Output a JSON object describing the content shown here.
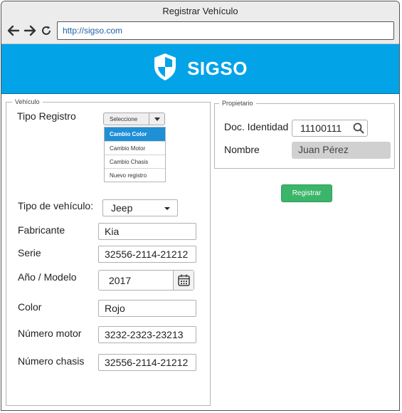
{
  "window": {
    "title": "Registrar Vehículo",
    "url": "http://sigso.com"
  },
  "header": {
    "brand": "SIGSO",
    "logo_icon": "shield-icon"
  },
  "vehiculo": {
    "legend": "Vehículo",
    "tipo_registro": {
      "label": "Tipo Registro",
      "select_value": "Seleccione",
      "options": [
        "Cambio Color",
        "Cambio Motor",
        "Cambio Chasis",
        "Nuevo registro"
      ],
      "highlighted": "Cambio Color"
    },
    "tipo_vehiculo": {
      "label": "Tipo de vehículo:",
      "value": "Jeep"
    },
    "fabricante": {
      "label": "Fabricante",
      "value": "Kia"
    },
    "serie": {
      "label": "Serie",
      "value": "32556-2114-21212"
    },
    "anio_modelo": {
      "label": "Año / Modelo",
      "value": "2017",
      "icon": "calendar-icon"
    },
    "color": {
      "label": "Color",
      "value": "Rojo"
    },
    "numero_motor": {
      "label": "Número motor",
      "value": "3232-2323-23213"
    },
    "numero_chasis": {
      "label": "Número chasis",
      "value": "32556-2114-21212"
    }
  },
  "propietario": {
    "legend": "Propietario",
    "doc_identidad": {
      "label": "Doc. Identidad",
      "value": "11100111",
      "icon": "search-icon"
    },
    "nombre": {
      "label": "Nombre",
      "value": "Juan Pérez"
    }
  },
  "actions": {
    "register_label": "Registrar"
  },
  "colors": {
    "header_bg": "#03a3e8",
    "dropdown_highlight": "#1f8fd6",
    "button_green": "#3bb56a",
    "readonly_field": "#d0d0d0"
  }
}
